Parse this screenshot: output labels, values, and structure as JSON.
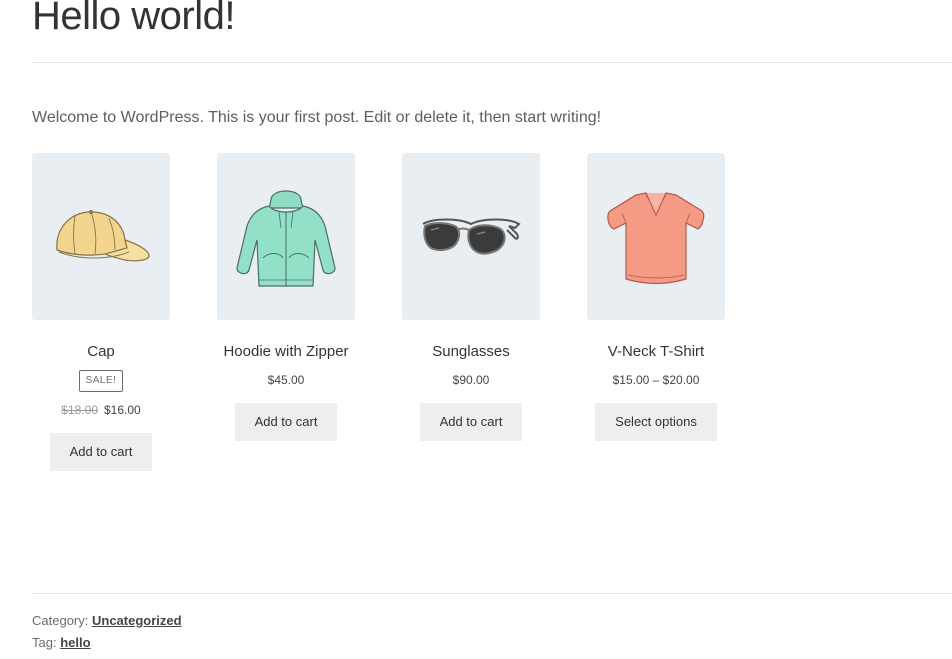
{
  "post": {
    "title": "Hello world!",
    "intro": "Welcome to WordPress. This is your first post. Edit or delete it, then start writing!"
  },
  "products": [
    {
      "name": "Cap",
      "sale_badge": "SALE!",
      "old_price": "$18.00",
      "price": "$16.00",
      "button": "Add to cart",
      "image": "cap-image"
    },
    {
      "name": "Hoodie with Zipper",
      "price": "$45.00",
      "button": "Add to cart",
      "image": "hoodie-image"
    },
    {
      "name": "Sunglasses",
      "price": "$90.00",
      "button": "Add to cart",
      "image": "sunglasses-image"
    },
    {
      "name": "V-Neck T-Shirt",
      "price": "$15.00 – $20.00",
      "button": "Select options",
      "image": "tshirt-image"
    }
  ],
  "footer": {
    "category_label": "Category:",
    "category_link": "Uncategorized",
    "tag_label": "Tag:",
    "tag_link": "hello"
  },
  "colors": {
    "thumb_bg": "#e9eef3",
    "button_bg": "#eeeeee",
    "text": "#43454b"
  }
}
